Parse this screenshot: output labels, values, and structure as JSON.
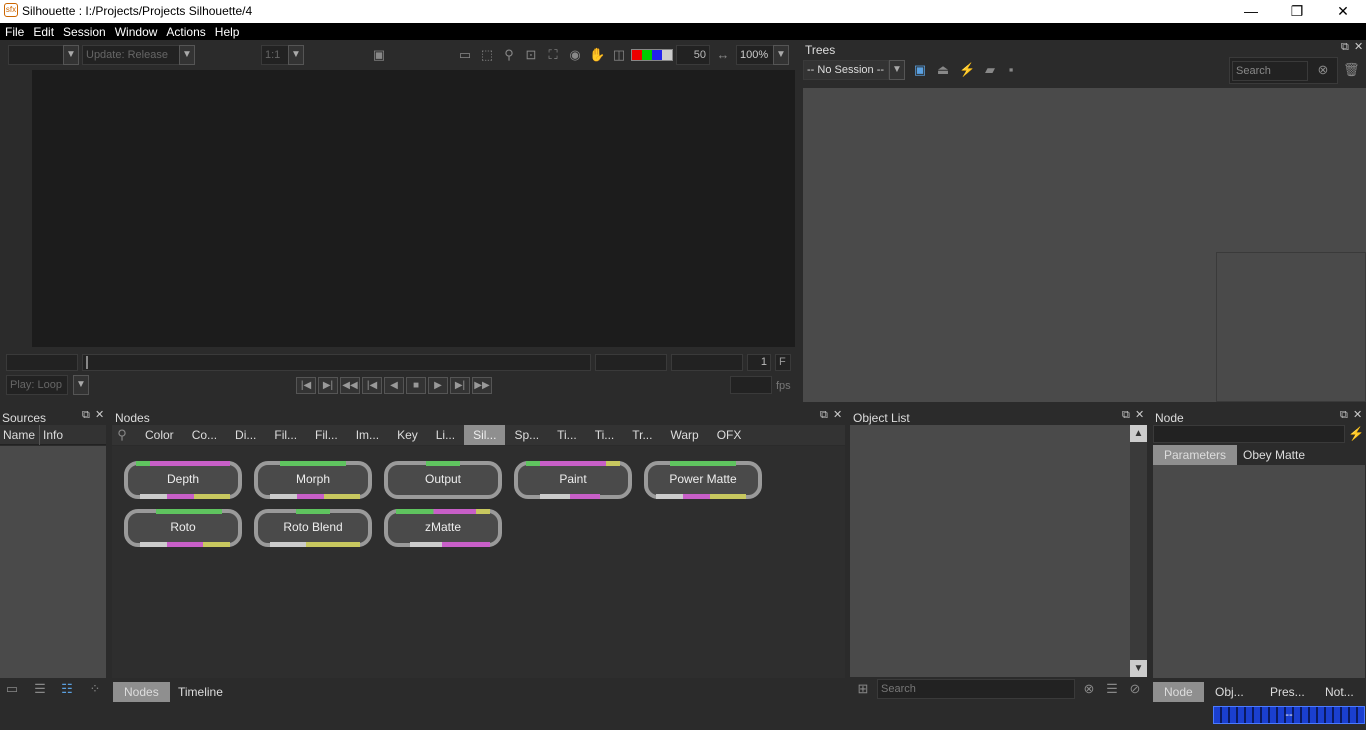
{
  "window": {
    "title": "Silhouette : I:/Projects/Projects Silhouette/4",
    "logo": "sfx",
    "minimize": "—",
    "restore": "❐",
    "close": "✕"
  },
  "menu": [
    "File",
    "Edit",
    "Session",
    "Window",
    "Actions",
    "Help"
  ],
  "viewer": {
    "update_placeholder": "Update: Release",
    "ratio": "1:1",
    "exposure": "50",
    "zoom": "100%",
    "frame": "1",
    "frame_btn": "F",
    "play_mode": "Play: Loop",
    "fps_label": "fps"
  },
  "trees": {
    "title": "Trees",
    "session": "-- No Session --",
    "search_placeholder": "Search"
  },
  "sources": {
    "title": "Sources",
    "col_name": "Name",
    "col_info": "Info"
  },
  "nodes": {
    "title": "Nodes",
    "categories": [
      "Color",
      "Co...",
      "Di...",
      "Fil...",
      "Fil...",
      "Im...",
      "Key",
      "Li...",
      "Sil...",
      "Sp...",
      "Ti...",
      "Ti...",
      "Tr...",
      "Warp",
      "OFX"
    ],
    "selected_category": "Sil...",
    "items": [
      "Depth",
      "Morph",
      "Output",
      "Paint",
      "Power Matte",
      "Roto",
      "Roto Blend",
      "zMatte"
    ],
    "bottom_tabs": [
      "Nodes",
      "Timeline"
    ]
  },
  "object_list": {
    "title": "Object List",
    "search_placeholder": "Search"
  },
  "node_panel": {
    "title": "Node",
    "tabs": [
      "Parameters",
      "Obey Matte"
    ],
    "bottom_tabs": [
      "Node",
      "Obj...",
      "Pres...",
      "Not..."
    ]
  },
  "status": {
    "progress_text": "--"
  },
  "colors": {
    "accent_green": "#5fc45f",
    "accent_pink": "#c85fc8",
    "accent_yellow": "#c8c85f",
    "accent_blue": "#6a6ad0",
    "progress": "#1a3fd0"
  }
}
